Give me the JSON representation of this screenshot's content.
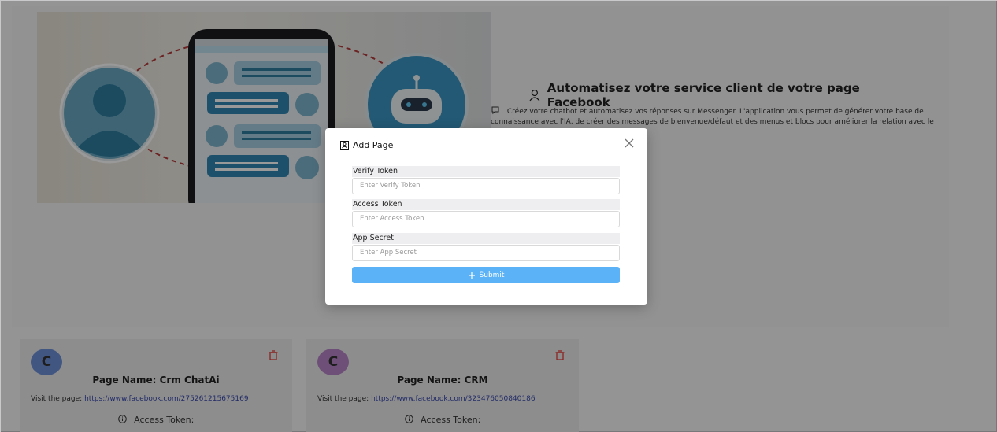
{
  "hero": {
    "title": "Automatisez votre service client de votre page Facebook",
    "description": "Créez votre chatbot et automatisez vos réponses sur Messenger. L'application vous permet de générer votre base de connaissance avec l'IA, de créer des messages de bienvenue/défaut et des menus et blocs pour améliorer la relation avec le consommateur."
  },
  "cards": [
    {
      "avatar_letter": "C",
      "avatar_color": "#6d8fd8",
      "page_name_label": "Page Name:",
      "page_name": "Crm ChatAi",
      "visit_label": "Visit the page:",
      "url": "https://www.facebook.com/275261215675169",
      "token_label": "Access Token:"
    },
    {
      "avatar_letter": "C",
      "avatar_color": "#b784c9",
      "page_name_label": "Page Name:",
      "page_name": "CRM",
      "visit_label": "Visit the page:",
      "url": "https://www.facebook.com/323476050840186",
      "token_label": "Access Token:"
    }
  ],
  "modal": {
    "title": "Add Page",
    "fields": [
      {
        "label": "Verify Token",
        "placeholder": "Enter Verify Token"
      },
      {
        "label": "Access Token",
        "placeholder": "Enter Access Token"
      },
      {
        "label": "App Secret",
        "placeholder": "Enter App Secret"
      }
    ],
    "submit_label": "Submit"
  },
  "colors": {
    "accent": "#5cb2f7",
    "link": "#3949ab",
    "delete": "#e53935",
    "overlay": "rgba(0,0,0,0.40)"
  },
  "icons": [
    "person-icon",
    "chat-icon",
    "trash-icon",
    "info-icon",
    "page-icon",
    "close-icon",
    "plus-icon"
  ]
}
